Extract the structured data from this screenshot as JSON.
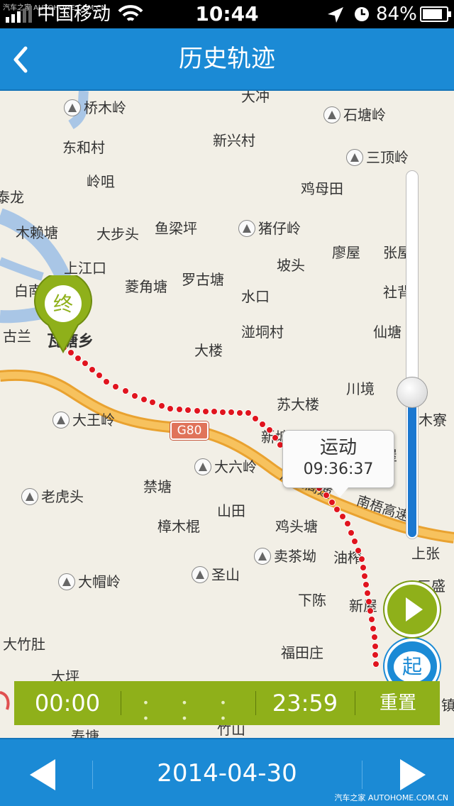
{
  "watermark_top": "汽车之家 AUTOHOME.COM.CN",
  "watermark_bottom": "汽车之家 AUTOHOME.COM.CN",
  "status": {
    "carrier": "中国移动",
    "time": "10:44",
    "battery": "84%",
    "battery_level": 0.84
  },
  "nav": {
    "title": "历史轨迹"
  },
  "map": {
    "highway_label": "G80",
    "highway_name": "南梧高速",
    "highway_partial": "广昆高速",
    "places": [
      {
        "name": "桥木岭",
        "poi": true
      },
      {
        "name": "大冲",
        "poi": false
      },
      {
        "name": "石塘岭",
        "poi": true
      },
      {
        "name": "东和村",
        "poi": false
      },
      {
        "name": "新兴村",
        "poi": false
      },
      {
        "name": "三顶岭",
        "poi": true
      },
      {
        "name": "岭咀",
        "poi": false
      },
      {
        "name": "鸡母田",
        "poi": false
      },
      {
        "name": "泰龙",
        "poi": false
      },
      {
        "name": "木赖塘",
        "poi": false
      },
      {
        "name": "大步头",
        "poi": false
      },
      {
        "name": "鱼梁坪",
        "poi": false
      },
      {
        "name": "猪仔岭",
        "poi": true
      },
      {
        "name": "上江口",
        "poi": false
      },
      {
        "name": "坡头",
        "poi": false
      },
      {
        "name": "廖屋",
        "poi": false
      },
      {
        "name": "张屋",
        "poi": false
      },
      {
        "name": "白南",
        "poi": false
      },
      {
        "name": "菱角塘",
        "poi": false
      },
      {
        "name": "罗古塘",
        "poi": false
      },
      {
        "name": "水口",
        "poi": false
      },
      {
        "name": "社背",
        "poi": false
      },
      {
        "name": "古兰",
        "poi": false
      },
      {
        "name": "瓦塘乡",
        "poi": false
      },
      {
        "name": "大楼",
        "poi": false
      },
      {
        "name": "湴垌村",
        "poi": false
      },
      {
        "name": "仙塘",
        "poi": false
      },
      {
        "name": "川境",
        "poi": false
      },
      {
        "name": "苏大楼",
        "poi": false
      },
      {
        "name": "大王岭",
        "poi": true
      },
      {
        "name": "木寮",
        "poi": false
      },
      {
        "name": "新塘",
        "poi": false
      },
      {
        "name": "翁屋",
        "poi": false
      },
      {
        "name": "大六岭",
        "poi": true
      },
      {
        "name": "老虎头",
        "poi": true
      },
      {
        "name": "禁塘",
        "poi": false
      },
      {
        "name": "山田",
        "poi": false
      },
      {
        "name": "樟木棍",
        "poi": false
      },
      {
        "name": "鸡头塘",
        "poi": false
      },
      {
        "name": "上张",
        "poi": false
      },
      {
        "name": "卖茶坳",
        "poi": true
      },
      {
        "name": "油榨",
        "poi": false
      },
      {
        "name": "大帽岭",
        "poi": true
      },
      {
        "name": "圣山",
        "poi": true
      },
      {
        "name": "三盛",
        "poi": false
      },
      {
        "name": "下陈",
        "poi": false
      },
      {
        "name": "新屋",
        "poi": false
      },
      {
        "name": "大竹肚",
        "poi": false
      },
      {
        "name": "福田庄",
        "poi": false
      },
      {
        "name": "大坪",
        "poi": false
      },
      {
        "name": "竹山",
        "poi": false
      },
      {
        "name": "寿塘",
        "poi": false
      },
      {
        "name": "镇",
        "poi": false
      }
    ],
    "end_marker_label": "终",
    "start_marker_label": "起",
    "bubble": {
      "status": "运动",
      "time": "09:36:37"
    },
    "zoom_level": 0.4
  },
  "timebar": {
    "start": "00:00",
    "dots": "• • • • • •",
    "end": "23:59",
    "reset": "重置"
  },
  "bottom": {
    "date": "2014-04-30"
  }
}
